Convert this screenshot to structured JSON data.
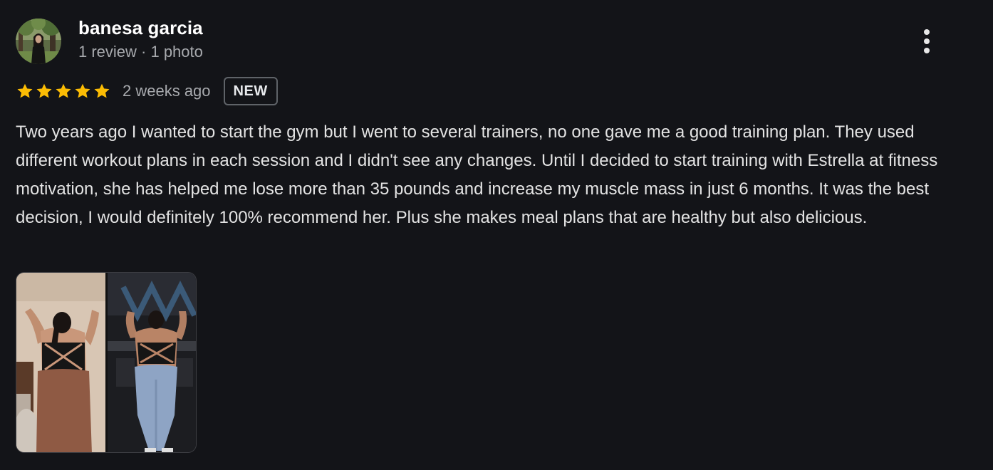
{
  "review": {
    "author": {
      "name": "banesa garcia",
      "meta": "1 review · 1 photo"
    },
    "rating": {
      "stars": 5,
      "max": 5,
      "color": "#fbbc04"
    },
    "time": "2 weeks ago",
    "badge": "NEW",
    "text": "Two years ago I wanted to start the gym but I went to several trainers, no one gave me a good training plan. They used different workout plans in each session and I didn't see any changes. Until I decided to start training with Estrella at fitness motivation, she has helped me lose more than 35 pounds and increase my muscle mass in just 6 months. It was the best decision, I would definitely 100% recommend her. Plus she makes meal plans that are healthy but also delicious.",
    "photo_count": 1,
    "more_options_icon": "more-vert-icon"
  },
  "colors": {
    "background": "#131418",
    "text": "#e3e3e3",
    "muted": "#a8aaae",
    "star": "#fbbc04"
  }
}
